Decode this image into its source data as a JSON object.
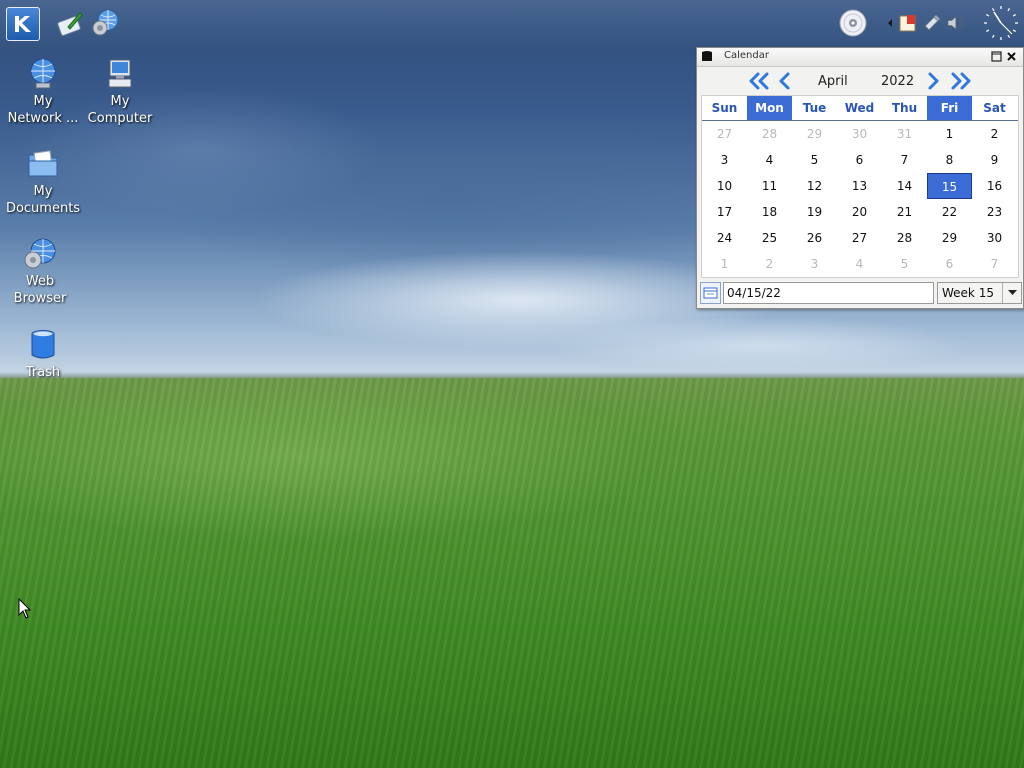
{
  "desktop": {
    "icons": [
      {
        "name": "network",
        "label_line1": "My",
        "label_line2": "Network ..."
      },
      {
        "name": "computer",
        "label_line1": "My",
        "label_line2": "Computer"
      },
      {
        "name": "documents",
        "label_line1": "My",
        "label_line2": "Documents"
      },
      {
        "name": "web-browser",
        "label_line1": "Web",
        "label_line2": "Browser"
      },
      {
        "name": "trash",
        "label_line1": "Trash",
        "label_line2": ""
      }
    ]
  },
  "panel": {
    "launchers": [
      "kmenu-icon",
      "text-editor-icon",
      "control-center-icon"
    ],
    "tray": [
      "cd-icon",
      "tray-arrow-icon",
      "notes-icon",
      "klipper-icon",
      "volume-icon",
      "analog-clock-icon"
    ]
  },
  "calendar": {
    "window_title": "Calendar",
    "month": "April",
    "year": "2022",
    "weekdays": [
      "Sun",
      "Mon",
      "Tue",
      "Wed",
      "Thu",
      "Fri",
      "Sat"
    ],
    "highlighted_weekdays": [
      1,
      5
    ],
    "weeks": [
      [
        "27",
        "28",
        "29",
        "30",
        "31",
        "1",
        "2"
      ],
      [
        "3",
        "4",
        "5",
        "6",
        "7",
        "8",
        "9"
      ],
      [
        "10",
        "11",
        "12",
        "13",
        "14",
        "15",
        "16"
      ],
      [
        "17",
        "18",
        "19",
        "20",
        "21",
        "22",
        "23"
      ],
      [
        "24",
        "25",
        "26",
        "27",
        "28",
        "29",
        "30"
      ],
      [
        "1",
        "2",
        "3",
        "4",
        "5",
        "6",
        "7"
      ]
    ],
    "selected_day": "15",
    "date_value": "04/15/22",
    "week_label": "Week 15"
  },
  "colors": {
    "accent": "#3b6cd6",
    "weekday_text": "#2a55b8"
  }
}
